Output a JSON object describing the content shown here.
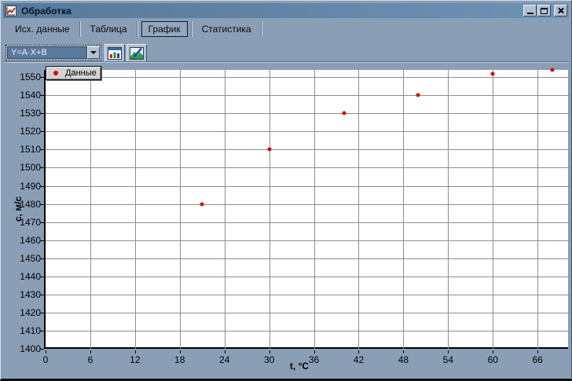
{
  "window": {
    "title": "Обработка"
  },
  "tabs": [
    {
      "name": "tab-source-data",
      "label": "Исх. данные",
      "active": false
    },
    {
      "name": "tab-table",
      "label": "Таблица",
      "active": false
    },
    {
      "name": "tab-graph",
      "label": "График",
      "active": true
    },
    {
      "name": "tab-statistics",
      "label": "Статистика",
      "active": false
    }
  ],
  "toolbar": {
    "formula_combo": {
      "value": "Y=A·X+B"
    },
    "buttons": [
      {
        "name": "chart-type-button",
        "icon": "bar-chart-icon"
      },
      {
        "name": "edit-chart-button",
        "icon": "edit-image-icon"
      }
    ]
  },
  "colors": {
    "titlebar": "#5d81a2",
    "window_bg": "#8a9fb6",
    "plot_bg": "#ffffff",
    "gridline": "#8e8e8e",
    "point": "#e60000"
  },
  "chart_data": {
    "type": "scatter",
    "xlabel": "t, °C",
    "ylabel": "c, м/с",
    "xlim": [
      0,
      70.3
    ],
    "ylim": [
      1400,
      1554
    ],
    "x_ticks": [
      0,
      6,
      12,
      18,
      24,
      30,
      36,
      42,
      48,
      54,
      60,
      66
    ],
    "y_ticks": [
      1400,
      1410,
      1420,
      1430,
      1440,
      1450,
      1460,
      1470,
      1480,
      1490,
      1500,
      1510,
      1520,
      1530,
      1540,
      1550
    ],
    "grid": true,
    "legend": {
      "position": "top-left",
      "label": "Данные"
    },
    "series": [
      {
        "name": "Данные",
        "marker": "circle",
        "color": "#e60000",
        "points": [
          [
            21,
            1480
          ],
          [
            30,
            1510
          ],
          [
            40,
            1530
          ],
          [
            50,
            1540
          ],
          [
            60,
            1552
          ],
          [
            68,
            1554
          ]
        ]
      }
    ]
  }
}
